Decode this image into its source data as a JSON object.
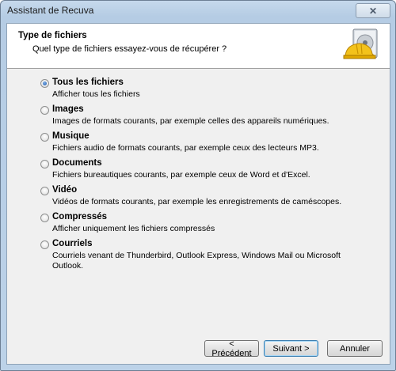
{
  "window": {
    "title": "Assistant de Recuva",
    "close_symbol": "✕"
  },
  "header": {
    "title": "Type de fichiers",
    "subtitle": "Quel type de fichiers essayez-vous de récupérer ?",
    "logo_icon": "recuva-helmet-drive-icon"
  },
  "options": [
    {
      "label": "Tous les fichiers",
      "description": "Afficher tous les fichiers",
      "checked": true
    },
    {
      "label": "Images",
      "description": "Images de formats courants, par exemple celles des appareils numériques.",
      "checked": false
    },
    {
      "label": "Musique",
      "description": "Fichiers audio de formats courants, par exemple ceux des lecteurs MP3.",
      "checked": false
    },
    {
      "label": "Documents",
      "description": "Fichiers bureautiques courants, par exemple ceux de Word et d'Excel.",
      "checked": false
    },
    {
      "label": "Vidéo",
      "description": "Vidéos de formats courants, par exemple les enregistrements de caméscopes.",
      "checked": false
    },
    {
      "label": "Compressés",
      "description": "Afficher uniquement les fichiers compressés",
      "checked": false
    },
    {
      "label": "Courriels",
      "description": "Courriels venant de Thunderbird, Outlook Express, Windows Mail ou Microsoft Outlook.",
      "checked": false
    }
  ],
  "buttons": {
    "back": "< Précédent",
    "next": "Suivant >",
    "cancel": "Annuler"
  }
}
